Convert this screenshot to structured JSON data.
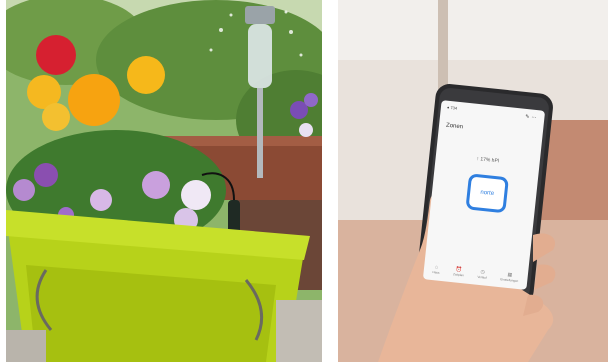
{
  "left_photo": {
    "icon": "garden-planter-photo"
  },
  "right_photo": {
    "icon": "hand-holding-phone-photo",
    "phone_screen": {
      "status_left": "● 734",
      "title": "Zonen",
      "humidity": "↑ 17% hPl",
      "zone_button_label": "norte",
      "tabs": [
        {
          "icon": "home-icon",
          "label": "Haus"
        },
        {
          "icon": "alarm-icon",
          "label": "Zeitplan"
        },
        {
          "icon": "clock-icon",
          "label": "Verlauf"
        },
        {
          "icon": "grid-icon",
          "label": "Einstellungen"
        }
      ]
    }
  }
}
